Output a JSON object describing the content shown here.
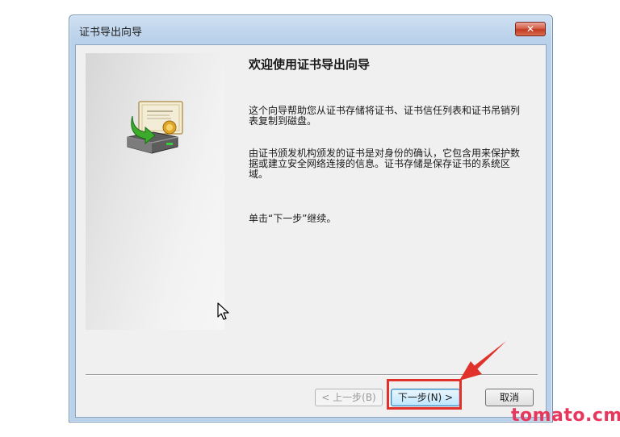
{
  "window": {
    "title": "证书导出向导",
    "close_symbol": "✕"
  },
  "wizard": {
    "heading": "欢迎使用证书导出向导",
    "paragraph1": "这个向导帮助您从证书存储将证书、证书信任列表和证书吊销列表复制到磁盘。",
    "paragraph2": "由证书颁发机构颁发的证书是对身份的确认，它包含用来保护数据或建立安全网络连接的信息。证书存储是保存证书的系统区域。",
    "paragraph3": "单击“下一步”继续。"
  },
  "buttons": {
    "back": "< 上一步(B)",
    "next": "下一步(N) >",
    "cancel": "取消"
  },
  "icons": {
    "wizard": "certificate-export-icon",
    "cursor": "mouse-pointer-icon",
    "annotation": "red-arrow-icon"
  },
  "colors": {
    "highlight": "#e0322a",
    "watermark": "#e8375d"
  },
  "watermark": "tomato.cm"
}
